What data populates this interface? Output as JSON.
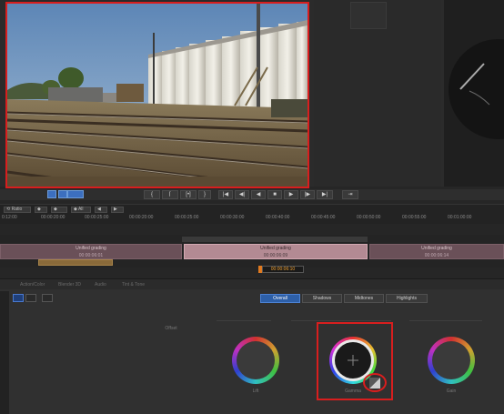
{
  "transport": {
    "buttons": [
      "{",
      "⌈",
      "[•]",
      "}",
      "|◀",
      "◀|",
      "◀",
      "■",
      "▶",
      "|▶",
      "▶|",
      "⇥"
    ]
  },
  "ruler": {
    "ctrl_left": "⟲ Ratio",
    "ctrl_all": "◆ All",
    "ticks": [
      "00:00:20:00",
      "00:00:25:00",
      "00:00:30:00",
      "00:00:35:00",
      "00:00:40:00",
      "00:00:45:00",
      "00:00:50:00",
      "00:00:55:00",
      "00:01:00:00"
    ]
  },
  "track": {
    "clips": [
      {
        "label": "Unified grading",
        "tc": "00:00:06:01"
      },
      {
        "label": "Unified grading",
        "tc": "00:00:06:09"
      },
      {
        "label": "Unified grading",
        "tc": "00:00:06:14"
      }
    ],
    "timecode": "00:00:06:10"
  },
  "tabs": [
    "Action/Color",
    "Blender 3D",
    "Audio",
    "Tint & Tone"
  ],
  "grading": {
    "segments": [
      "Overall",
      "Shadows",
      "Midtones",
      "Highlights"
    ],
    "wheels": [
      {
        "name": "Offset",
        "sublabel": "Lift"
      },
      {
        "name": "Gamma",
        "sublabel": "Gamma"
      },
      {
        "name": "Gain",
        "sublabel": "Gain"
      }
    ]
  },
  "colors": {
    "highlight": "#d81e1e",
    "accent": "#2d5fa8",
    "clip": "#6a5058",
    "timecode": "#f0a030"
  }
}
